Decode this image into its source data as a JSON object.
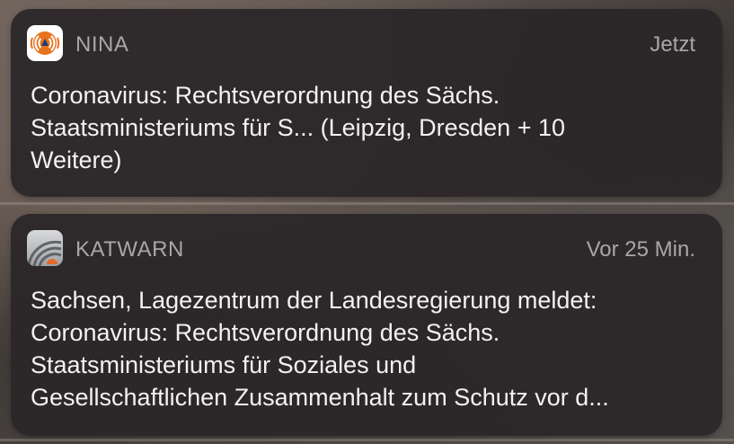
{
  "notifications": [
    {
      "app": "NINA",
      "time": "Jetzt",
      "icon": "nina-warning-icon",
      "lines": [
        "Coronavirus: Rechtsverordnung des Sächs.",
        "Staatsministeriums für S... (Leipzig, Dresden + 10",
        "Weitere)"
      ]
    },
    {
      "app": "KATWARN",
      "time": "Vor 25 Min.",
      "icon": "katwarn-icon",
      "lines": [
        "Sachsen, Lagezentrum der Landesregierung meldet:",
        "Coronavirus: Rechtsverordnung des Sächs.",
        "Staatsministeriums für Soziales und",
        "Gesellschaftlichen Zusammenhalt zum Schutz vor d..."
      ]
    }
  ],
  "colors": {
    "nina_orange": "#e8731f",
    "katwarn_orange": "#e56a25"
  }
}
